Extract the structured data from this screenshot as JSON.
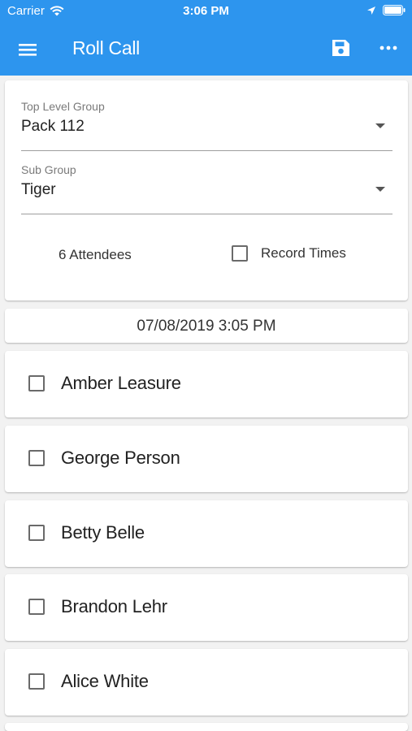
{
  "status_bar": {
    "carrier": "Carrier",
    "time": "3:06 PM"
  },
  "app_bar": {
    "title": "Roll Call",
    "background_color": "#2d95ee",
    "icons": [
      "menu-icon",
      "save-icon",
      "more-icon"
    ]
  },
  "form": {
    "top_level_group": {
      "label": "Top Level Group",
      "value": "Pack 112"
    },
    "sub_group": {
      "label": "Sub Group",
      "value": "Tiger"
    },
    "attendees_text": "6 Attendees",
    "record_times_label": "Record Times",
    "record_times_checked": false
  },
  "datetime": "07/08/2019 3:05 PM",
  "attendees": [
    {
      "name": "Amber Leasure",
      "checked": false
    },
    {
      "name": "George Person",
      "checked": false
    },
    {
      "name": "Betty Belle",
      "checked": false
    },
    {
      "name": "Brandon Lehr",
      "checked": false
    },
    {
      "name": "Alice White",
      "checked": false
    }
  ]
}
